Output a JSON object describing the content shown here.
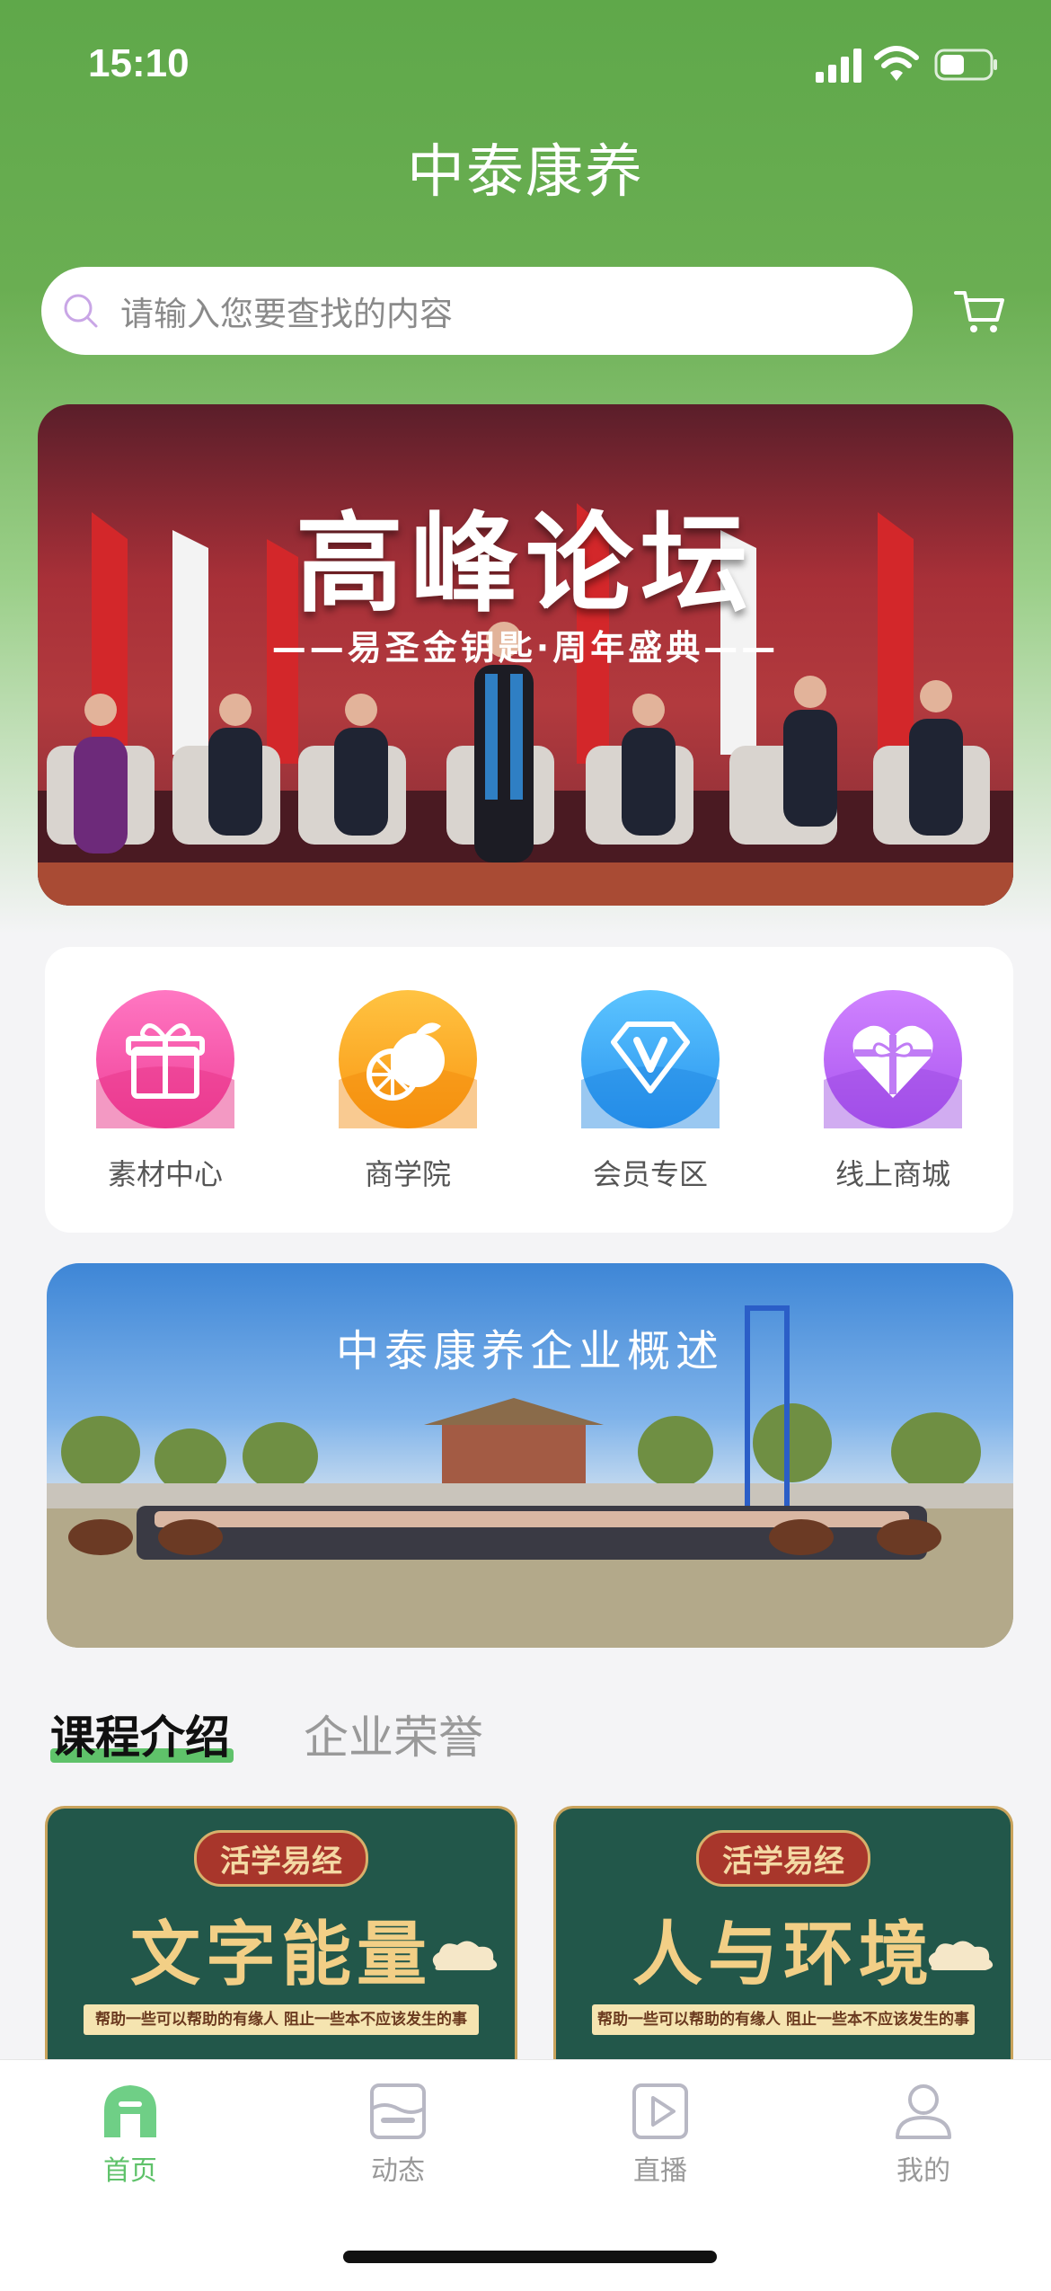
{
  "status_bar": {
    "time": "15:10"
  },
  "app": {
    "title": "中泰康养"
  },
  "search": {
    "placeholder": "请输入您要查找的内容"
  },
  "banner": {
    "title": "高峰论坛",
    "subtitle": "——易圣金钥匙·周年盛典——"
  },
  "quick_menu": [
    {
      "label": "素材中心",
      "icon": "gift-icon",
      "color": "#f34fa6"
    },
    {
      "label": "商学院",
      "icon": "orange-icon",
      "color": "#f9a21f"
    },
    {
      "label": "会员专区",
      "icon": "vip-diamond-icon",
      "color": "#35a6f2"
    },
    {
      "label": "线上商城",
      "icon": "gift-heart-icon",
      "color": "#b25ef0"
    }
  ],
  "overview": {
    "title": "中泰康养企业概述"
  },
  "content_tabs": {
    "active": "课程介绍",
    "inactive": "企业荣誉"
  },
  "courses": [
    {
      "tag": "活学易经",
      "title": "文字能量",
      "desc": "帮助一些可以帮助的有缘人  阻止一些本不应该发生的事"
    },
    {
      "tag": "活学易经",
      "title": "人与环境",
      "desc": "帮助一些可以帮助的有缘人  阻止一些本不应该发生的事"
    }
  ],
  "tabbar": [
    {
      "label": "首页",
      "icon": "home-icon",
      "active": true
    },
    {
      "label": "动态",
      "icon": "feed-icon",
      "active": false
    },
    {
      "label": "直播",
      "icon": "play-icon",
      "active": false
    },
    {
      "label": "我的",
      "icon": "user-icon",
      "active": false
    }
  ],
  "colors": {
    "brand_green": "#5fa84a",
    "accent_green": "#5fc26a"
  }
}
